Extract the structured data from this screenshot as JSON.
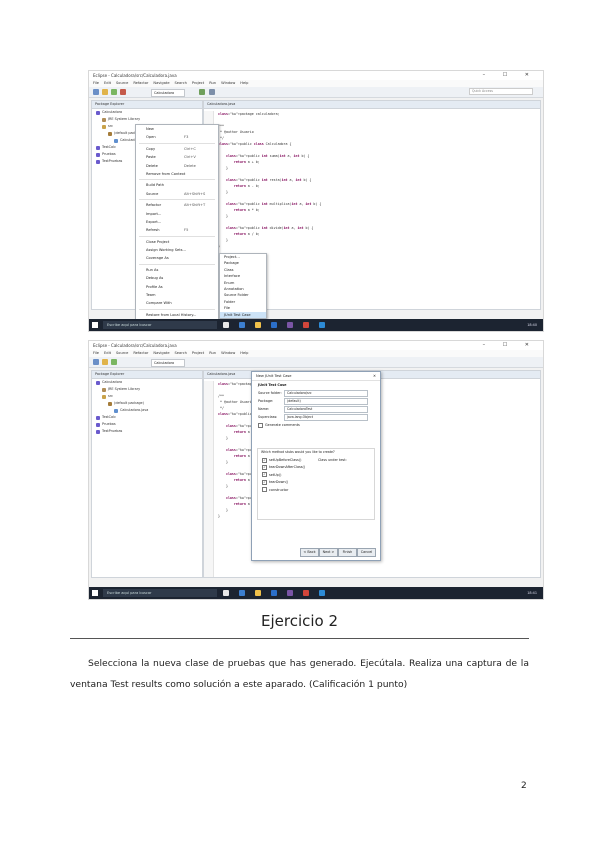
{
  "screenshot1": {
    "title": "Eclipse - Calculadora/src/Calculadora.java",
    "menu": [
      "File",
      "Edit",
      "Source",
      "Refactor",
      "Navigate",
      "Search",
      "Project",
      "Run",
      "Window",
      "Help"
    ],
    "quick_access": "Quick Access",
    "run_combo": "Calculadora",
    "explorer_tab": "Package Explorer",
    "tree": [
      "Calculadora",
      "JRE System Library",
      "src",
      "(default package)",
      "Calculadora.java",
      "TestCalc",
      "Pruebas",
      "TestPruebas"
    ],
    "editor_tab": "Calculadora.java",
    "code": [
      "package calculadora;",
      "",
      "/**",
      " * @author Usuario",
      " */",
      "public class Calculadora {",
      "",
      "    public int suma(int a, int b) {",
      "        return a + b;",
      "    }",
      "",
      "    public int resta(int a, int b) {",
      "        return a - b;",
      "    }",
      "",
      "    public int multiplica(int a, int b) {",
      "        return a * b;",
      "    }",
      "",
      "    public int divide(int a, int b) {",
      "        return a / b;",
      "    }",
      "}"
    ],
    "context_menu": [
      {
        "label": "New",
        "shortcut": ""
      },
      {
        "label": "Open",
        "shortcut": "F3"
      },
      {
        "label": "Copy",
        "shortcut": "Ctrl+C"
      },
      {
        "label": "Paste",
        "shortcut": "Ctrl+V"
      },
      {
        "label": "Delete",
        "shortcut": "Delete"
      },
      {
        "label": "Remove from Context",
        "shortcut": ""
      },
      {
        "label": "Build Path",
        "shortcut": ""
      },
      {
        "label": "Source",
        "shortcut": "Alt+Shift+S"
      },
      {
        "label": "Refactor",
        "shortcut": "Alt+Shift+T"
      },
      {
        "label": "Import...",
        "shortcut": ""
      },
      {
        "label": "Export...",
        "shortcut": ""
      },
      {
        "label": "Refresh",
        "shortcut": "F5"
      },
      {
        "label": "Close Project",
        "shortcut": ""
      },
      {
        "label": "Assign Working Sets...",
        "shortcut": ""
      },
      {
        "label": "Coverage As",
        "shortcut": ""
      },
      {
        "label": "Run As",
        "shortcut": ""
      },
      {
        "label": "Debug As",
        "shortcut": ""
      },
      {
        "label": "Profile As",
        "shortcut": ""
      },
      {
        "label": "Team",
        "shortcut": ""
      },
      {
        "label": "Compare With",
        "shortcut": ""
      },
      {
        "label": "Restore from Local History...",
        "shortcut": ""
      },
      {
        "label": "Properties",
        "shortcut": "Alt+Enter"
      },
      {
        "label": "New",
        "shortcut": ""
      }
    ],
    "submenu": [
      "Project...",
      "Package",
      "Class",
      "Interface",
      "Enum",
      "Annotation",
      "Source Folder",
      "Folder",
      "File",
      "JUnit Test Case"
    ],
    "taskbar_search": "Escribe aquí para buscar",
    "clock": "18:40"
  },
  "screenshot2": {
    "title": "Eclipse - Calculadora/src/Calculadora.java",
    "dialog_title": "New JUnit Test Case",
    "dialog_subtitle": "JUnit Test Case",
    "fields": [
      {
        "label": "Source folder:",
        "value": "Calculadora/src"
      },
      {
        "label": "Package:",
        "value": "(default)"
      },
      {
        "label": "Name:",
        "value": "CalculadoraTest"
      },
      {
        "label": "Superclass:",
        "value": "java.lang.Object"
      }
    ],
    "stubs_label": "Which method stubs would you like to create?",
    "stubs": [
      "setUpBeforeClass()",
      "tearDownAfterClass()",
      "setUp()",
      "tearDown()",
      "constructor"
    ],
    "options": [
      "Generate comments",
      "Class under test:"
    ],
    "buttons": [
      "< Back",
      "Next >",
      "Finish",
      "Cancel"
    ],
    "taskbar_search": "Escribe aquí para buscar",
    "clock": "18:41"
  },
  "heading": "Ejercicio 2",
  "paragraph": "Selecciona la nueva clase de pruebas que has generado. Ejecútala. Realiza una captura de la ventana Test results como solución a este aparado. (Calificación 1 punto)",
  "page_number": "2"
}
